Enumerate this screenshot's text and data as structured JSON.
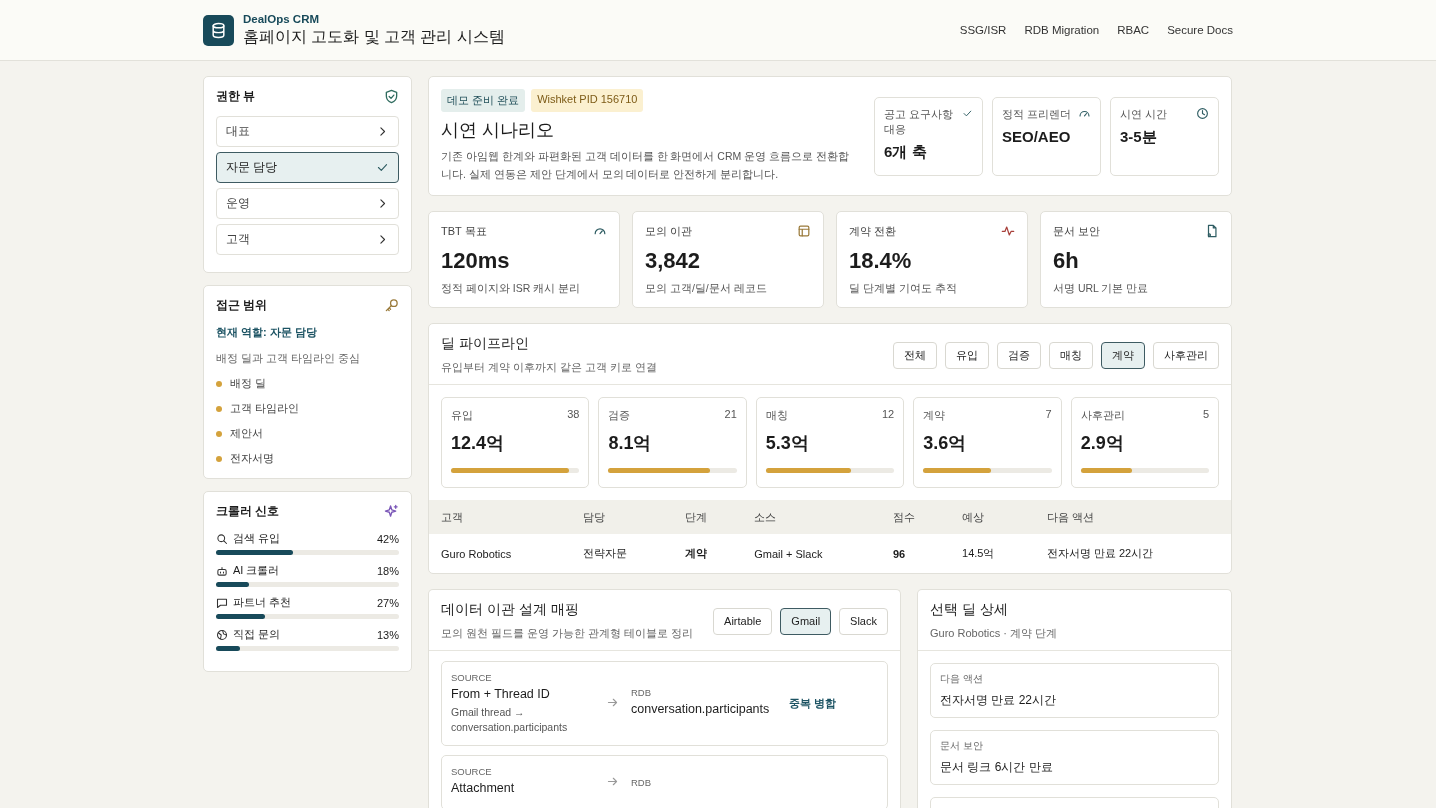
{
  "header": {
    "brand": "DealOps CRM",
    "title": "홈페이지 고도화 및 고객 관리 시스템",
    "nav": [
      "SSG/ISR",
      "RDB Migration",
      "RBAC",
      "Secure Docs"
    ]
  },
  "sidebar": {
    "roles": {
      "title": "권한 뷰",
      "items": [
        {
          "label": "대표",
          "selected": false
        },
        {
          "label": "자문 담당",
          "selected": true
        },
        {
          "label": "운영",
          "selected": false
        },
        {
          "label": "고객",
          "selected": false
        }
      ]
    },
    "scope": {
      "title": "접근 범위",
      "role": "현재 역할: 자문 담당",
      "desc": "배정 딜과 고객 타임라인 중심",
      "items": [
        "배정 딜",
        "고객 타임라인",
        "제안서",
        "전자서명"
      ]
    },
    "crawler": {
      "title": "크롤러 신호",
      "items": [
        {
          "label": "검색 유입",
          "value": "42%",
          "level": 0.42
        },
        {
          "label": "AI 크롤러",
          "value": "18%",
          "level": 0.18
        },
        {
          "label": "파트너 추천",
          "value": "27%",
          "level": 0.27
        },
        {
          "label": "직접 문의",
          "value": "13%",
          "level": 0.13
        }
      ]
    }
  },
  "scenario": {
    "badges": [
      "데모 준비 완료",
      "Wishket PID 156710"
    ],
    "title": "시연 시나리오",
    "desc": "기존 아임웹 한계와 파편화된 고객 데이터를 한 화면에서 CRM 운영 흐름으로 전환합니다. 실제 연동은 제안 단계에서 모의 데이터로 안전하게 분리합니다.",
    "facts": [
      {
        "label": "공고 요구사항 대응",
        "value": "6개 축"
      },
      {
        "label": "정적 프리렌더",
        "value": "SEO/AEO"
      },
      {
        "label": "시연 시간",
        "value": "3-5분"
      }
    ]
  },
  "metrics": [
    {
      "label": "TBT 목표",
      "value": "120ms",
      "note": "정적 페이지와 ISR 캐시 분리"
    },
    {
      "label": "모의 이관",
      "value": "3,842",
      "note": "모의 고객/딜/문서 레코드"
    },
    {
      "label": "계약 전환",
      "value": "18.4%",
      "note": "딜 단계별 기여도 추적"
    },
    {
      "label": "문서 보안",
      "value": "6h",
      "note": "서명 URL 기본 만료"
    }
  ],
  "pipeline": {
    "title": "딜 파이프라인",
    "subtitle": "유입부터 계약 이후까지 같은 고객 키로 연결",
    "filters": [
      {
        "label": "전체",
        "selected": false
      },
      {
        "label": "유입",
        "selected": false
      },
      {
        "label": "검증",
        "selected": false
      },
      {
        "label": "매칭",
        "selected": false
      },
      {
        "label": "계약",
        "selected": true
      },
      {
        "label": "사후관리",
        "selected": false
      }
    ],
    "stages": [
      {
        "name": "유입",
        "count": "38",
        "amount": "12.4억",
        "level": 0.92
      },
      {
        "name": "검증",
        "count": "21",
        "amount": "8.1억",
        "level": 0.79
      },
      {
        "name": "매칭",
        "count": "12",
        "amount": "5.3억",
        "level": 0.66
      },
      {
        "name": "계약",
        "count": "7",
        "amount": "3.6억",
        "level": 0.53
      },
      {
        "name": "사후관리",
        "count": "5",
        "amount": "2.9억",
        "level": 0.4
      }
    ],
    "table": {
      "columns": [
        "고객",
        "담당",
        "단계",
        "소스",
        "점수",
        "예상",
        "다음 액션"
      ],
      "rows": [
        [
          "Guro Robotics",
          "전략자문",
          "계약",
          "Gmail + Slack",
          "96",
          "14.5억",
          "전자서명 만료 22시간"
        ]
      ]
    }
  },
  "mapping": {
    "title": "데이터 이관 설계 매핑",
    "subtitle": "모의 원천 필드를 운영 가능한 관계형 테이블로 정리",
    "sources": [
      {
        "label": "Airtable",
        "selected": false
      },
      {
        "label": "Gmail",
        "selected": true
      },
      {
        "label": "Slack",
        "selected": false
      }
    ],
    "rows": [
      {
        "source_label": "SOURCE",
        "source": "From + Thread ID",
        "detail": "Gmail thread → conversation.participants",
        "target_label": "RDB",
        "target": "conversation.participants",
        "rule": "중복 병합"
      },
      {
        "source_label": "SOURCE",
        "source": "Attachment",
        "target_label": "RDB"
      }
    ]
  },
  "detail": {
    "title": "선택 딜 상세",
    "subtitle": "Guro Robotics · 계약 단계",
    "items": [
      {
        "label": "다음 액션",
        "value": "전자서명 만료 22시간"
      },
      {
        "label": "문서 보안",
        "value": "문서 링크 6시간 만료"
      }
    ]
  }
}
